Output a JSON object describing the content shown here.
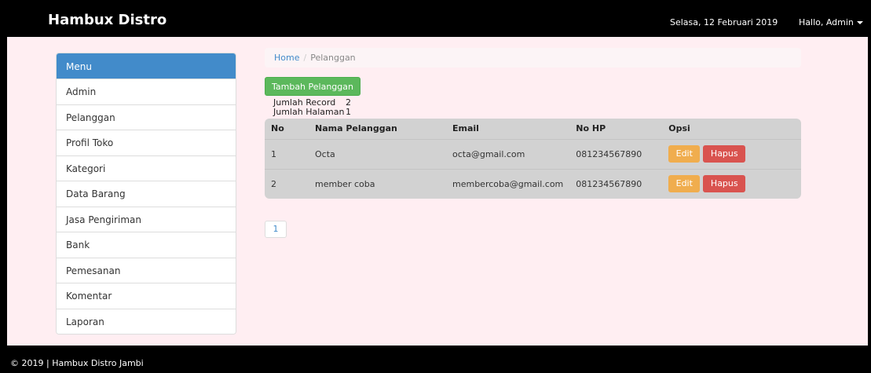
{
  "navbar": {
    "brand": "Hambux Distro",
    "date": "Selasa, 12 Februari 2019",
    "user": "Hallo, Admin"
  },
  "sidebar": {
    "header": "Menu",
    "items": [
      {
        "label": "Admin"
      },
      {
        "label": "Pelanggan"
      },
      {
        "label": "Profil Toko"
      },
      {
        "label": "Kategori"
      },
      {
        "label": "Data Barang"
      },
      {
        "label": "Jasa Pengiriman"
      },
      {
        "label": "Bank"
      },
      {
        "label": "Pemesanan"
      },
      {
        "label": "Komentar"
      },
      {
        "label": "Laporan"
      }
    ]
  },
  "breadcrumb": {
    "home": "Home",
    "separator": "/",
    "current": "Pelanggan"
  },
  "actions": {
    "add_label": "Tambah Pelanggan"
  },
  "record_info": {
    "record_label": "Jumlah Record",
    "record_value": "2",
    "page_label": "Jumlah Halaman",
    "page_value": "1"
  },
  "table": {
    "headers": [
      "No",
      "Nama Pelanggan",
      "Email",
      "No HP",
      "Opsi"
    ],
    "rows": [
      {
        "no": "1",
        "name": "Octa",
        "email": "octa@gmail.com",
        "hp": "081234567890",
        "edit": "Edit",
        "delete": "Hapus"
      },
      {
        "no": "2",
        "name": "member coba",
        "email": "membercoba@gmail.com",
        "hp": "081234567890",
        "edit": "Edit",
        "delete": "Hapus"
      }
    ]
  },
  "pagination": {
    "current": "1"
  },
  "footer": {
    "text": "© 2019 |   Hambux Distro Jambi"
  },
  "colors": {
    "primary": "#428bca",
    "success": "#5cb85c",
    "warning": "#f0ad4e",
    "danger": "#d9534f",
    "content_bg": "#ffeef2"
  }
}
